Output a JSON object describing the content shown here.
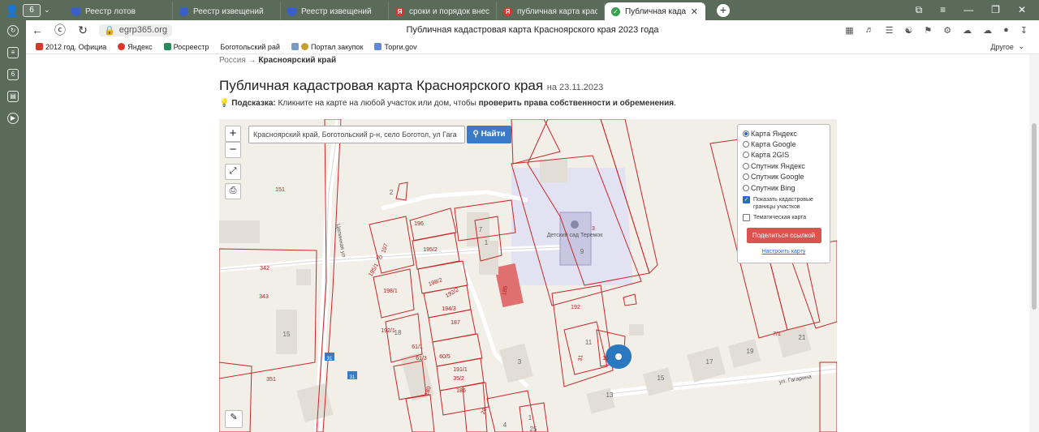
{
  "browser": {
    "tab_count": "6",
    "tabs": [
      {
        "label": "Реестр лотов",
        "icon": "shield"
      },
      {
        "label": "Реестр извещений",
        "icon": "shield"
      },
      {
        "label": "Реестр извещений",
        "icon": "shield"
      },
      {
        "label": "сроки и порядок внесения",
        "icon": "yandex"
      },
      {
        "label": "публичная карта красноярс",
        "icon": "yandex"
      },
      {
        "label": "Публичная кадастрова",
        "icon": "check",
        "active": true
      }
    ],
    "url": "egrp365.org",
    "page_title": "Публичная кадастровая карта Красноярского края 2023 года",
    "bookmarks": [
      "2012 год. Официа",
      "Яндекс",
      "Росреестр",
      "Боготольский рай",
      "Портал закупок",
      "Торги.gov"
    ],
    "bookmarks_other": "Другое"
  },
  "page": {
    "breadcrumb_root": "Россия",
    "breadcrumb_sep": " → ",
    "breadcrumb_current": "Красноярский край",
    "title": "Публичная кадастровая карта Красноярского края",
    "title_date": "на 23.11.2023",
    "hint_label": "Подсказка:",
    "hint_text": " Кликните на карте на любой участок или дом, чтобы ",
    "hint_bold": "проверить права собственности и обременения",
    "hint_end": "."
  },
  "map": {
    "search_value": "Красноярский край, Боготольский р-н, село Боготол, ул Гага",
    "find_label": "Найти",
    "zoom_in": "+",
    "zoom_out": "−",
    "layers": [
      "Карта Яндекс",
      "Карта Google",
      "Карта 2GIS",
      "Спутник Яндекс",
      "Спутник Google",
      "Спутник Bing"
    ],
    "selected_layer": "Карта Яндекс",
    "show_borders_label": "Показать кадастровые границы участков",
    "show_borders": true,
    "thematic_label": "Тематическая карта",
    "thematic": false,
    "share_label": "Поделиться ссылкой",
    "configure_label": "Настроить карту",
    "street_tselinnaya": "Целинная ул",
    "street_gagarina": "ул. Гагарина",
    "kindergarten": "Детский сад Теремок",
    "route_badge": "31",
    "parcel_labels": [
      "151",
      "342",
      "343",
      "351",
      "196",
      "197",
      "195/2",
      "195/1",
      "20",
      "198/1",
      "198/2",
      "192/2",
      "194/3",
      "187",
      "185",
      "192/1",
      "61/1",
      "61/3",
      "60/5",
      "191/1",
      "35/2",
      "186",
      "180",
      "28",
      "3",
      "192",
      "31",
      "10",
      "7/1"
    ],
    "house_numbers": [
      "7",
      "1",
      "9",
      "15",
      "18",
      "3",
      "15",
      "17",
      "19",
      "21",
      "13",
      "1",
      "4",
      "25",
      "11",
      "2"
    ]
  }
}
